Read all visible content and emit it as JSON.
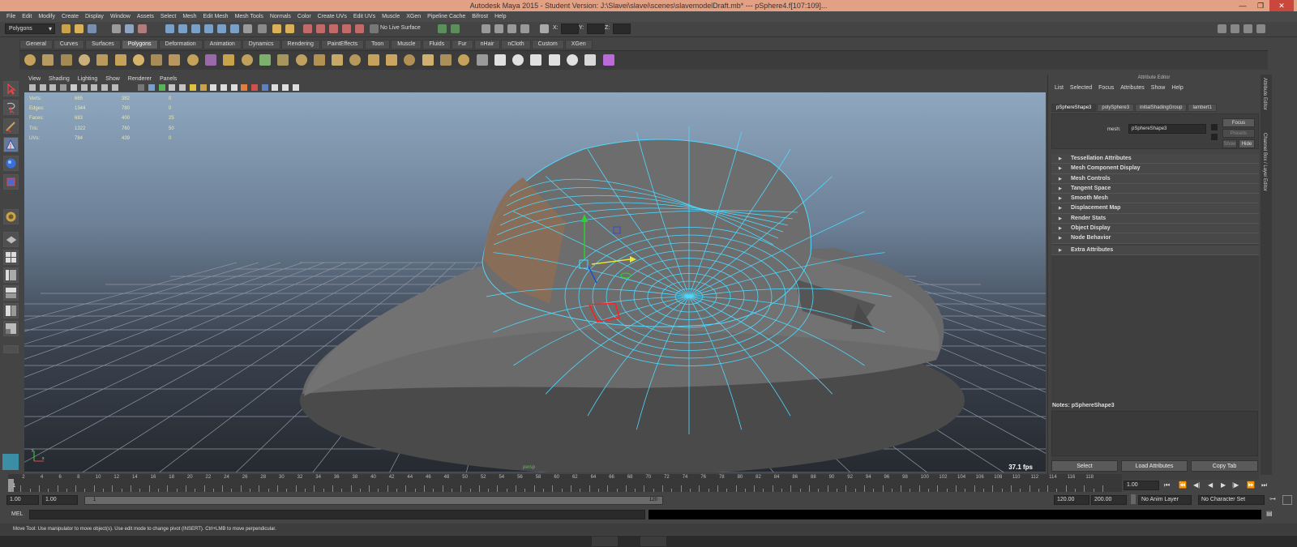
{
  "window": {
    "title": "Autodesk Maya 2015 - Student Version: J:\\Slavei\\slavei\\scenes\\slavemodelDraft.mb*  ---  pSphere4.f[107:109]..."
  },
  "menubar": [
    "File",
    "Edit",
    "Modify",
    "Create",
    "Display",
    "Window",
    "Assets",
    "Select",
    "Mesh",
    "Edit Mesh",
    "Mesh Tools",
    "Normals",
    "Color",
    "Create UVs",
    "Edit UVs",
    "Muscle",
    "XGen",
    "Pipeline Cache",
    "Bifrost",
    "Help"
  ],
  "statusline": {
    "mode": "Polygons",
    "live_surface": "No Live Surface",
    "x_label": "X:",
    "y_label": "Y:",
    "z_label": "Z:"
  },
  "shelf_tabs": [
    "General",
    "Curves",
    "Surfaces",
    "Polygons",
    "Deformation",
    "Animation",
    "Dynamics",
    "Rendering",
    "PaintEffects",
    "Toon",
    "Muscle",
    "Fluids",
    "Fur",
    "nHair",
    "nCloth",
    "Custom",
    "XGen"
  ],
  "shelf_active": "Polygons",
  "viewport": {
    "menu": [
      "View",
      "Shading",
      "Lighting",
      "Show",
      "Renderer",
      "Panels"
    ],
    "hud": [
      {
        "label": "Verts:",
        "a": "665",
        "b": "382",
        "c": "0"
      },
      {
        "label": "Edges:",
        "a": "1344",
        "b": "780",
        "c": "0"
      },
      {
        "label": "Faces:",
        "a": "683",
        "b": "400",
        "c": "25"
      },
      {
        "label": "Tris:",
        "a": "1322",
        "b": "760",
        "c": "50"
      },
      {
        "label": "UVs:",
        "a": "784",
        "b": "439",
        "c": "0"
      }
    ],
    "camera": "persp",
    "fps": "37.1 fps"
  },
  "attribute_editor": {
    "title": "Attribute Editor",
    "menu": [
      "List",
      "Selected",
      "Focus",
      "Attributes",
      "Show",
      "Help"
    ],
    "tabs": [
      "pSphereShape3",
      "polySphere3",
      "initialShadingGroup",
      "lambert1"
    ],
    "mesh_label": "mesh:",
    "mesh_value": "pSphereShape3",
    "focus": "Focus",
    "presets": "Presets",
    "show": "Show",
    "hide": "Hide",
    "sections": [
      "Tessellation Attributes",
      "Mesh Component Display",
      "Mesh Controls",
      "Tangent Space",
      "Smooth Mesh",
      "Displacement Map",
      "Render Stats",
      "Object Display",
      "Node Behavior",
      "Extra Attributes"
    ],
    "notes_label": "Notes:  pSphereShape3",
    "buttons": {
      "select": "Select",
      "load": "Load Attributes",
      "copy": "Copy Tab"
    }
  },
  "side_tabs": [
    "Attribute Editor",
    "Channel Box / Layer Editor"
  ],
  "timeline": {
    "ticks": [
      "2",
      "4",
      "6",
      "8",
      "10",
      "12",
      "14",
      "16",
      "18",
      "20",
      "22",
      "24",
      "26",
      "28",
      "30",
      "32",
      "34",
      "36",
      "38",
      "40",
      "42",
      "44",
      "46",
      "48",
      "50",
      "52",
      "54",
      "56",
      "58",
      "60",
      "62",
      "64",
      "66",
      "68",
      "70",
      "72",
      "74",
      "76",
      "78",
      "80",
      "82",
      "84",
      "86",
      "88",
      "90",
      "92",
      "94",
      "96",
      "98",
      "100",
      "102",
      "104",
      "106",
      "108",
      "110",
      "112",
      "114",
      "116",
      "118"
    ],
    "current": "1",
    "current_field": "1.00"
  },
  "range": {
    "start": "1.00",
    "start2": "1.00",
    "slider_label": "1",
    "slider_end": "120",
    "end": "120.00",
    "end2": "200.00",
    "anim_layer": "No Anim Layer",
    "char_set": "No Character Set"
  },
  "cmd": {
    "label": "MEL"
  },
  "help_line": "Move Tool: Use manipulator to move object(s). Use edit mode to change pivot (INSERT).  Ctrl+LMB to move perpendicular."
}
